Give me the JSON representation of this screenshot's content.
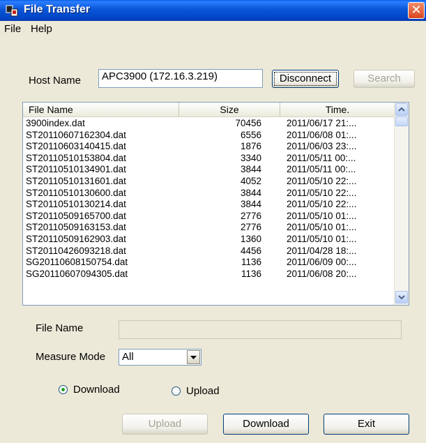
{
  "window": {
    "title": "File Transfer",
    "close_label": "✕"
  },
  "menu": {
    "items": [
      "File",
      "Help"
    ]
  },
  "host": {
    "label": "Host Name",
    "value": "APC3900 (172.16.3.219)",
    "disconnect_label": "Disconnect",
    "search_label": "Search"
  },
  "file_list": {
    "columns": [
      "File Name",
      "Size",
      "Time."
    ],
    "rows": [
      [
        "3900index.dat",
        "70456",
        "2011/06/17 21:..."
      ],
      [
        "ST20110607162304.dat",
        "6556",
        "2011/06/08 01:..."
      ],
      [
        "ST20110603140415.dat",
        "1876",
        "2011/06/03 23:..."
      ],
      [
        "ST20110510153804.dat",
        "3340",
        "2011/05/11 00:..."
      ],
      [
        "ST20110510134901.dat",
        "3844",
        "2011/05/11 00:..."
      ],
      [
        "ST20110510131601.dat",
        "4052",
        "2011/05/10 22:..."
      ],
      [
        "ST20110510130600.dat",
        "3844",
        "2011/05/10 22:..."
      ],
      [
        "ST20110510130214.dat",
        "3844",
        "2011/05/10 22:..."
      ],
      [
        "ST20110509165700.dat",
        "2776",
        "2011/05/10 01:..."
      ],
      [
        "ST20110509163153.dat",
        "2776",
        "2011/05/10 01:..."
      ],
      [
        "ST20110509162903.dat",
        "1360",
        "2011/05/10 01:..."
      ],
      [
        "ST20110426093218.dat",
        "4456",
        "2011/04/28 18:..."
      ],
      [
        "SG20110608150754.dat",
        "1136",
        "2011/06/09 00:..."
      ],
      [
        "SG20110607094305.dat",
        "1136",
        "2011/06/08 20:..."
      ]
    ]
  },
  "file_name": {
    "label": "File Name",
    "value": ""
  },
  "measure_mode": {
    "label": "Measure Mode",
    "selected": "All"
  },
  "transfer": {
    "download_label": "Download",
    "upload_label": "Upload",
    "selected": "Download"
  },
  "buttons": {
    "upload_label": "Upload",
    "download_label": "Download",
    "exit_label": "Exit"
  }
}
